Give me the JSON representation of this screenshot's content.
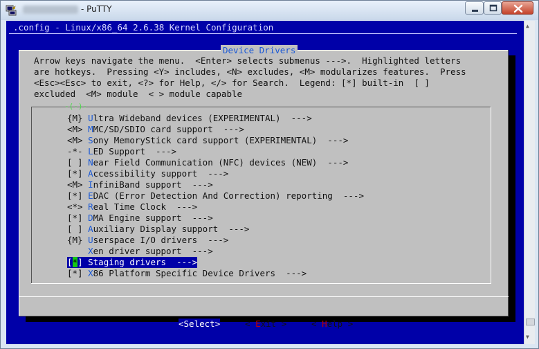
{
  "window": {
    "app_name": "PuTTY",
    "title_separator": " - "
  },
  "config_title": ".config - Linux/x86_64 2.6.38 Kernel Configuration",
  "dialog": {
    "title": "Device Drivers",
    "help_lines": [
      "Arrow keys navigate the menu.  <Enter> selects submenus --->.  Highlighted letters",
      "are hotkeys.  Pressing <Y> includes, <N> excludes, <M> modularizes features.  Press",
      "<Esc><Esc> to exit, <?> for Help, </> for Search.  Legend: [*] built-in  [ ]",
      "excluded  <M> module  < > module capable"
    ],
    "list_top_marker": "-(-)-",
    "items": [
      {
        "prefix": "{M} ",
        "hotkey": "U",
        "rest": "ltra Wideband devices (EXPERIMENTAL)",
        "tail": "  --->"
      },
      {
        "prefix": "<M> ",
        "hotkey": "M",
        "rest": "MC/SD/SDIO card support",
        "tail": "  --->"
      },
      {
        "prefix": "<M> ",
        "hotkey": "S",
        "rest": "ony MemoryStick card support (EXPERIMENTAL)",
        "tail": "  --->"
      },
      {
        "prefix": "-*- ",
        "hotkey": "L",
        "rest": "ED Support",
        "tail": "  --->"
      },
      {
        "prefix": "[ ] ",
        "hotkey": "N",
        "rest": "ear Field Communication (NFC) devices (NEW)",
        "tail": "  --->"
      },
      {
        "prefix": "[*] ",
        "hotkey": "A",
        "rest": "ccessibility support",
        "tail": "  --->"
      },
      {
        "prefix": "<M> ",
        "hotkey": "I",
        "rest": "nfiniBand support",
        "tail": "  --->"
      },
      {
        "prefix": "[*] ",
        "hotkey": "E",
        "rest": "DAC (Error Detection And Correction) reporting",
        "tail": "  --->"
      },
      {
        "prefix": "<*> ",
        "hotkey": "R",
        "rest": "eal Time Clock",
        "tail": "  --->"
      },
      {
        "prefix": "[*] ",
        "hotkey": "D",
        "rest": "MA Engine support",
        "tail": "  --->"
      },
      {
        "prefix": "[ ] ",
        "hotkey": "A",
        "rest": "uxiliary Display support",
        "tail": "  --->"
      },
      {
        "prefix": "{M} ",
        "hotkey": "U",
        "rest": "serspace I/O drivers",
        "tail": "  --->"
      },
      {
        "prefix": "    ",
        "hotkey": "X",
        "rest": "en driver support",
        "tail": "  --->"
      },
      {
        "prefix": "[*] ",
        "hotkey": "S",
        "rest": "taging drivers",
        "tail": "  --->",
        "selected": true
      },
      {
        "prefix": "[*] ",
        "hotkey": "X",
        "rest": "86 Platform Specific Device Drivers",
        "tail": "  --->"
      }
    ],
    "buttons": {
      "select": {
        "open": "<",
        "label": "Select",
        "close": ">"
      },
      "exit": {
        "open": "< ",
        "hotkey": "E",
        "rest": "xit",
        "close": " >"
      },
      "help": {
        "open": "< ",
        "hotkey": "H",
        "rest": "elp",
        "close": " >"
      }
    }
  },
  "colors": {
    "terminal_bg": "#0000a8",
    "dialog_bg": "#c0c0c0",
    "hotkey": "#1a59d6",
    "cursor": "#14c814"
  }
}
